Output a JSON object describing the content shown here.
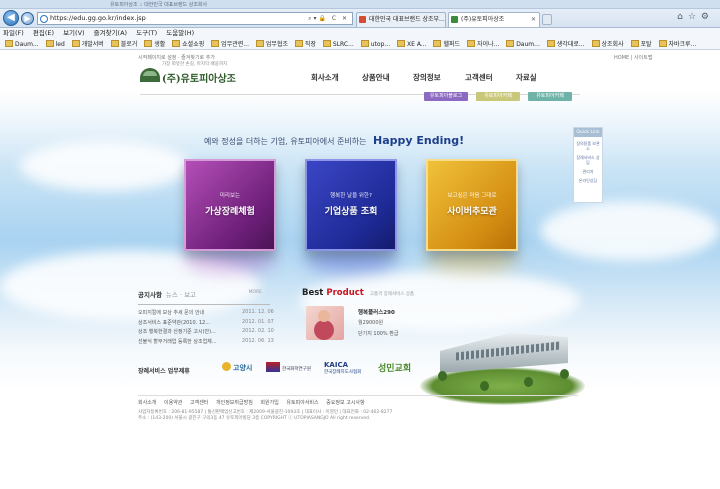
{
  "browser": {
    "window_title": "유토피아상조 :: 대한민국 대표브랜드 상조회사",
    "address_url": "https://edu.gg.go.kr/index.jsp",
    "tabs": [
      {
        "label": "대한민국 대표브랜드 상조부..."
      },
      {
        "label": "(주)유토피아상조"
      }
    ],
    "menu": [
      "파일(F)",
      "편집(E)",
      "보기(V)",
      "즐겨찾기(A)",
      "도구(T)",
      "도움말(H)"
    ],
    "favorites": [
      "Daum...",
      "led",
      "개발서버",
      "블로거",
      "생활",
      "쇼셜쇼핑",
      "업무관련...",
      "업무협조",
      "직장",
      "SLRC...",
      "utop...",
      "XE A...",
      "헬퍼드",
      "자이나...",
      "Daum...",
      "생각대로...",
      "상조회사",
      "포탈",
      "자바크루..."
    ]
  },
  "site": {
    "top_left_note": "시작페이지로 설정 · 즐겨찾기로 추가",
    "top_right_note": "HOME | 사이트맵",
    "logo_slogan": "가장 따뜻한 손길, 마지막 배웅까지",
    "logo_name": "(주)유토피아상조",
    "nav": [
      "회사소개",
      "상품안내",
      "장의정보",
      "고객센터",
      "자료실"
    ],
    "util_buttons": [
      "유토피아블로그",
      "유토피아카페",
      "유토피아카페"
    ],
    "tagline": "예와 정성을 더하는 기업, 유토피아에서 준비하는",
    "tagline_en": "Happy Ending!",
    "quick_link": {
      "title": "Quick Link",
      "items": [
        "장의용품 보관소",
        "장례서비스 상담",
        "관리자",
        "온라인상담"
      ]
    },
    "features": [
      {
        "sub": "미리보는",
        "title": "가상장례체험"
      },
      {
        "sub": "행복한 날을 위한?",
        "title": "기업상품 조회"
      },
      {
        "sub": "보고싶은 마음 그대로",
        "title": "사이버추모관"
      }
    ],
    "notice": {
      "title": "공지사항",
      "tabs": "뉴스 · 보고",
      "more": "MORE",
      "items": [
        {
          "title": "오피지컬에 보상 추세 문의 안내",
          "date": "2011. 12. 06"
        },
        {
          "title": "상조서비스 표준약관(2010. 12...",
          "date": "2012. 01. 07"
        },
        {
          "title": "상조 행복한결과 산정기준 고시(안)...",
          "date": "2012. 02. 10"
        },
        {
          "title": "선불식 할부거래업 등록한 상조업체...",
          "date": "2012. 06. 13"
        }
      ]
    },
    "best_product": {
      "title_a": "Best",
      "title_b": "Product",
      "subtitle": "고품격 장례서비스 상품",
      "name": "행복플러스290",
      "price": "월29000원",
      "detail": "단기지 100% 환급"
    },
    "partners": {
      "title": "장례서비스 업무제휴",
      "logos": [
        "고양시",
        "한국화학연구원",
        "KAICA",
        "성민교회"
      ],
      "kaica_sub": "한국장례지도사협회"
    },
    "footer": {
      "menu": [
        "회사소개",
        "이용약관",
        "고객센터",
        "개인정보취급방침",
        "회원가입",
        "유토피아서비스",
        "중요정보 고시사항"
      ],
      "line1": "사업자등록번호 : 206-81-95587 | 통신판매업신고번호 : 제2009-서울광진-1093호 | 대표이사 : 이영민 | 대표전화 : 02-462-8277",
      "line2": "주소 : (143-200) 서울시 광진구 구의3동 47 유토피아빌딩 3층 COPYRIGHT ⓒ UTOPIASANGJO All right reserved."
    }
  }
}
